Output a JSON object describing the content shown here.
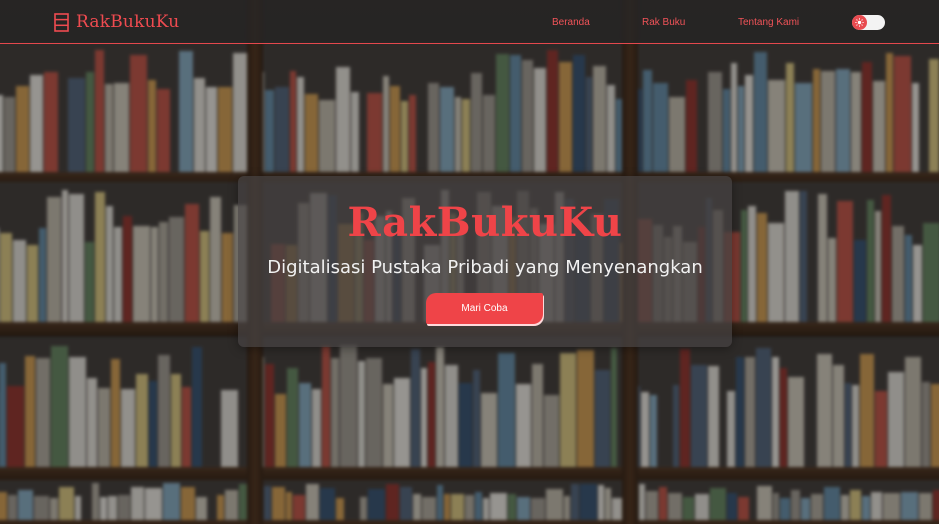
{
  "nav": {
    "brand": "RakBukuKu",
    "links": [
      "Beranda",
      "Rak Buku",
      "Tentang Kami"
    ]
  },
  "theme_toggle": {
    "icon": "sun-icon",
    "state": "light"
  },
  "hero": {
    "title": "RakBukuKu",
    "subtitle": "Digitalisasi Pustaka Pribadi yang Menyenangkan",
    "cta_label": "Mari Coba"
  },
  "colors": {
    "accent": "#ef4448",
    "nav_bg": "#282626",
    "hero_bg": "#464242",
    "text_light": "#f1f1f1"
  }
}
